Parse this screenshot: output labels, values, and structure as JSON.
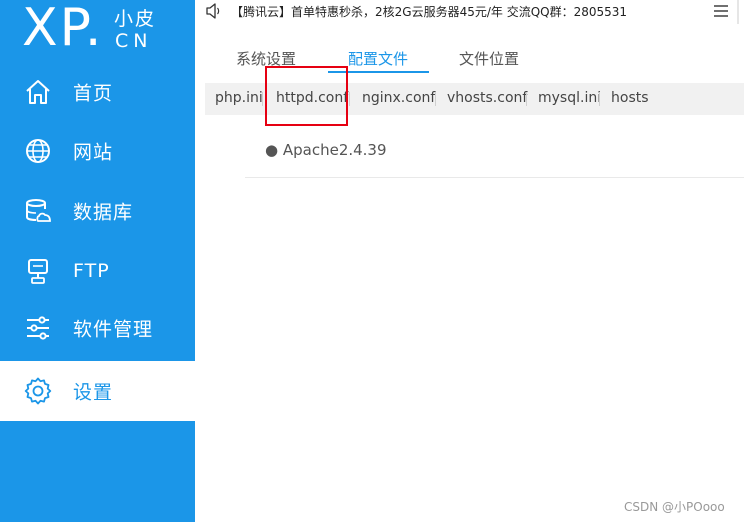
{
  "logo": {
    "brand": "XP.",
    "cn_top": "小皮",
    "cn_bottom": "CN"
  },
  "sidebar": {
    "items": [
      {
        "label": "首页",
        "icon": "home-icon"
      },
      {
        "label": "网站",
        "icon": "globe-icon"
      },
      {
        "label": "数据库",
        "icon": "database-icon"
      },
      {
        "label": "FTP",
        "icon": "server-icon"
      },
      {
        "label": "软件管理",
        "icon": "sliders-icon"
      },
      {
        "label": "设置",
        "icon": "gear-icon",
        "active": true
      }
    ]
  },
  "topbar": {
    "notice": "【腾讯云】首单特惠秒杀，2核2G云服务器45元/年 交流QQ群：2805531"
  },
  "tabs": [
    {
      "label": "系统设置"
    },
    {
      "label": "配置文件",
      "active": true
    },
    {
      "label": "文件位置"
    }
  ],
  "subtabs": [
    "php.ini",
    "httpd.conf",
    "nginx.conf",
    "vhosts.conf",
    "mysql.ini",
    "hosts"
  ],
  "entry": {
    "label": "● Apache2.4.39"
  },
  "watermark": "CSDN @小POooo",
  "colors": {
    "sidebar_blue": "#1b96e8",
    "highlight_red": "#e60012"
  }
}
